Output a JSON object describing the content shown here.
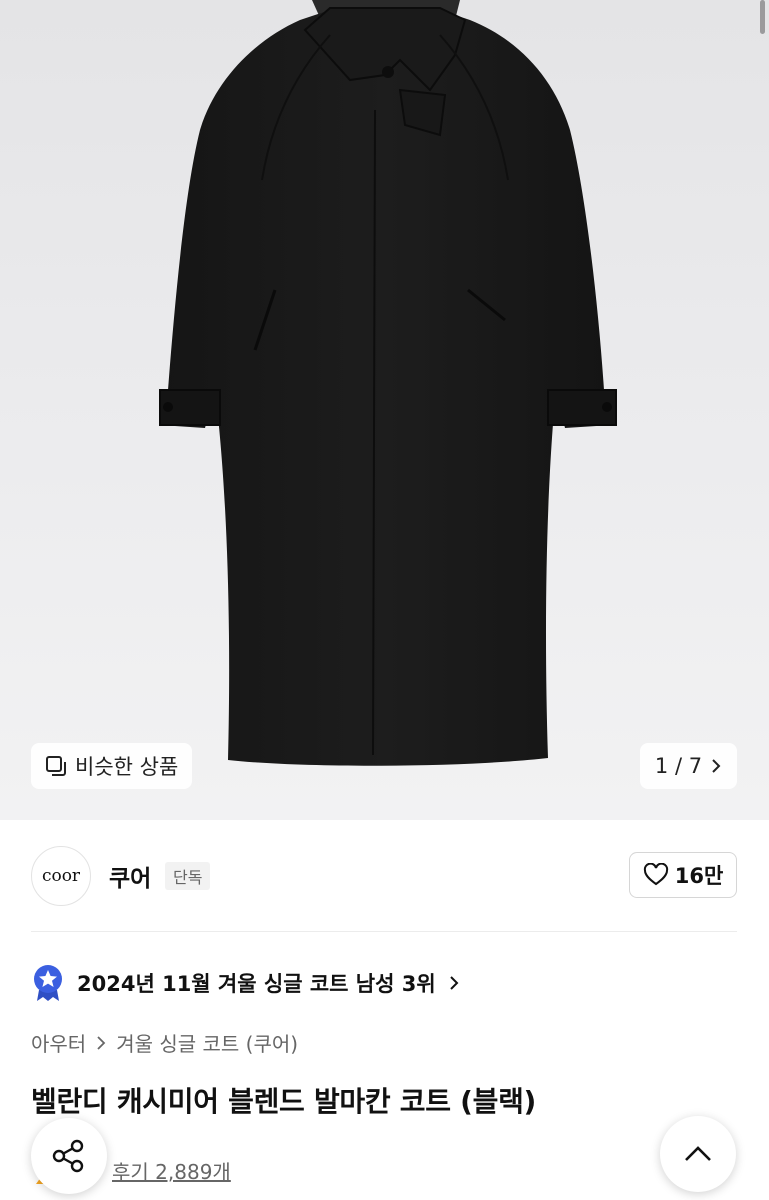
{
  "gallery": {
    "similar_label": "비슷한 상품",
    "counter": "1 / 7",
    "icons": {
      "similar": "copy-square-icon",
      "next": "chevron-right-icon"
    }
  },
  "brand": {
    "logo_text": "coor",
    "name": "쿠어",
    "badge": "단독",
    "likes": "16만",
    "like_icon": "heart-outline-icon"
  },
  "ranking": {
    "text": "2024년 11월 겨울 싱글 코트 남성 3위",
    "badge_icon": "star-medal-icon",
    "badge_color": "#3b5fe0"
  },
  "breadcrumb": {
    "category": "아우터",
    "subcategory": "겨울 싱글 코트 (쿠어)"
  },
  "product": {
    "title": "벨란디 캐시미어 블렌드 발마칸 코트 (블랙)",
    "reviews": "후기 2,889개"
  },
  "fabs": {
    "share_icon": "share-icon",
    "top_icon": "chevron-up-icon"
  }
}
